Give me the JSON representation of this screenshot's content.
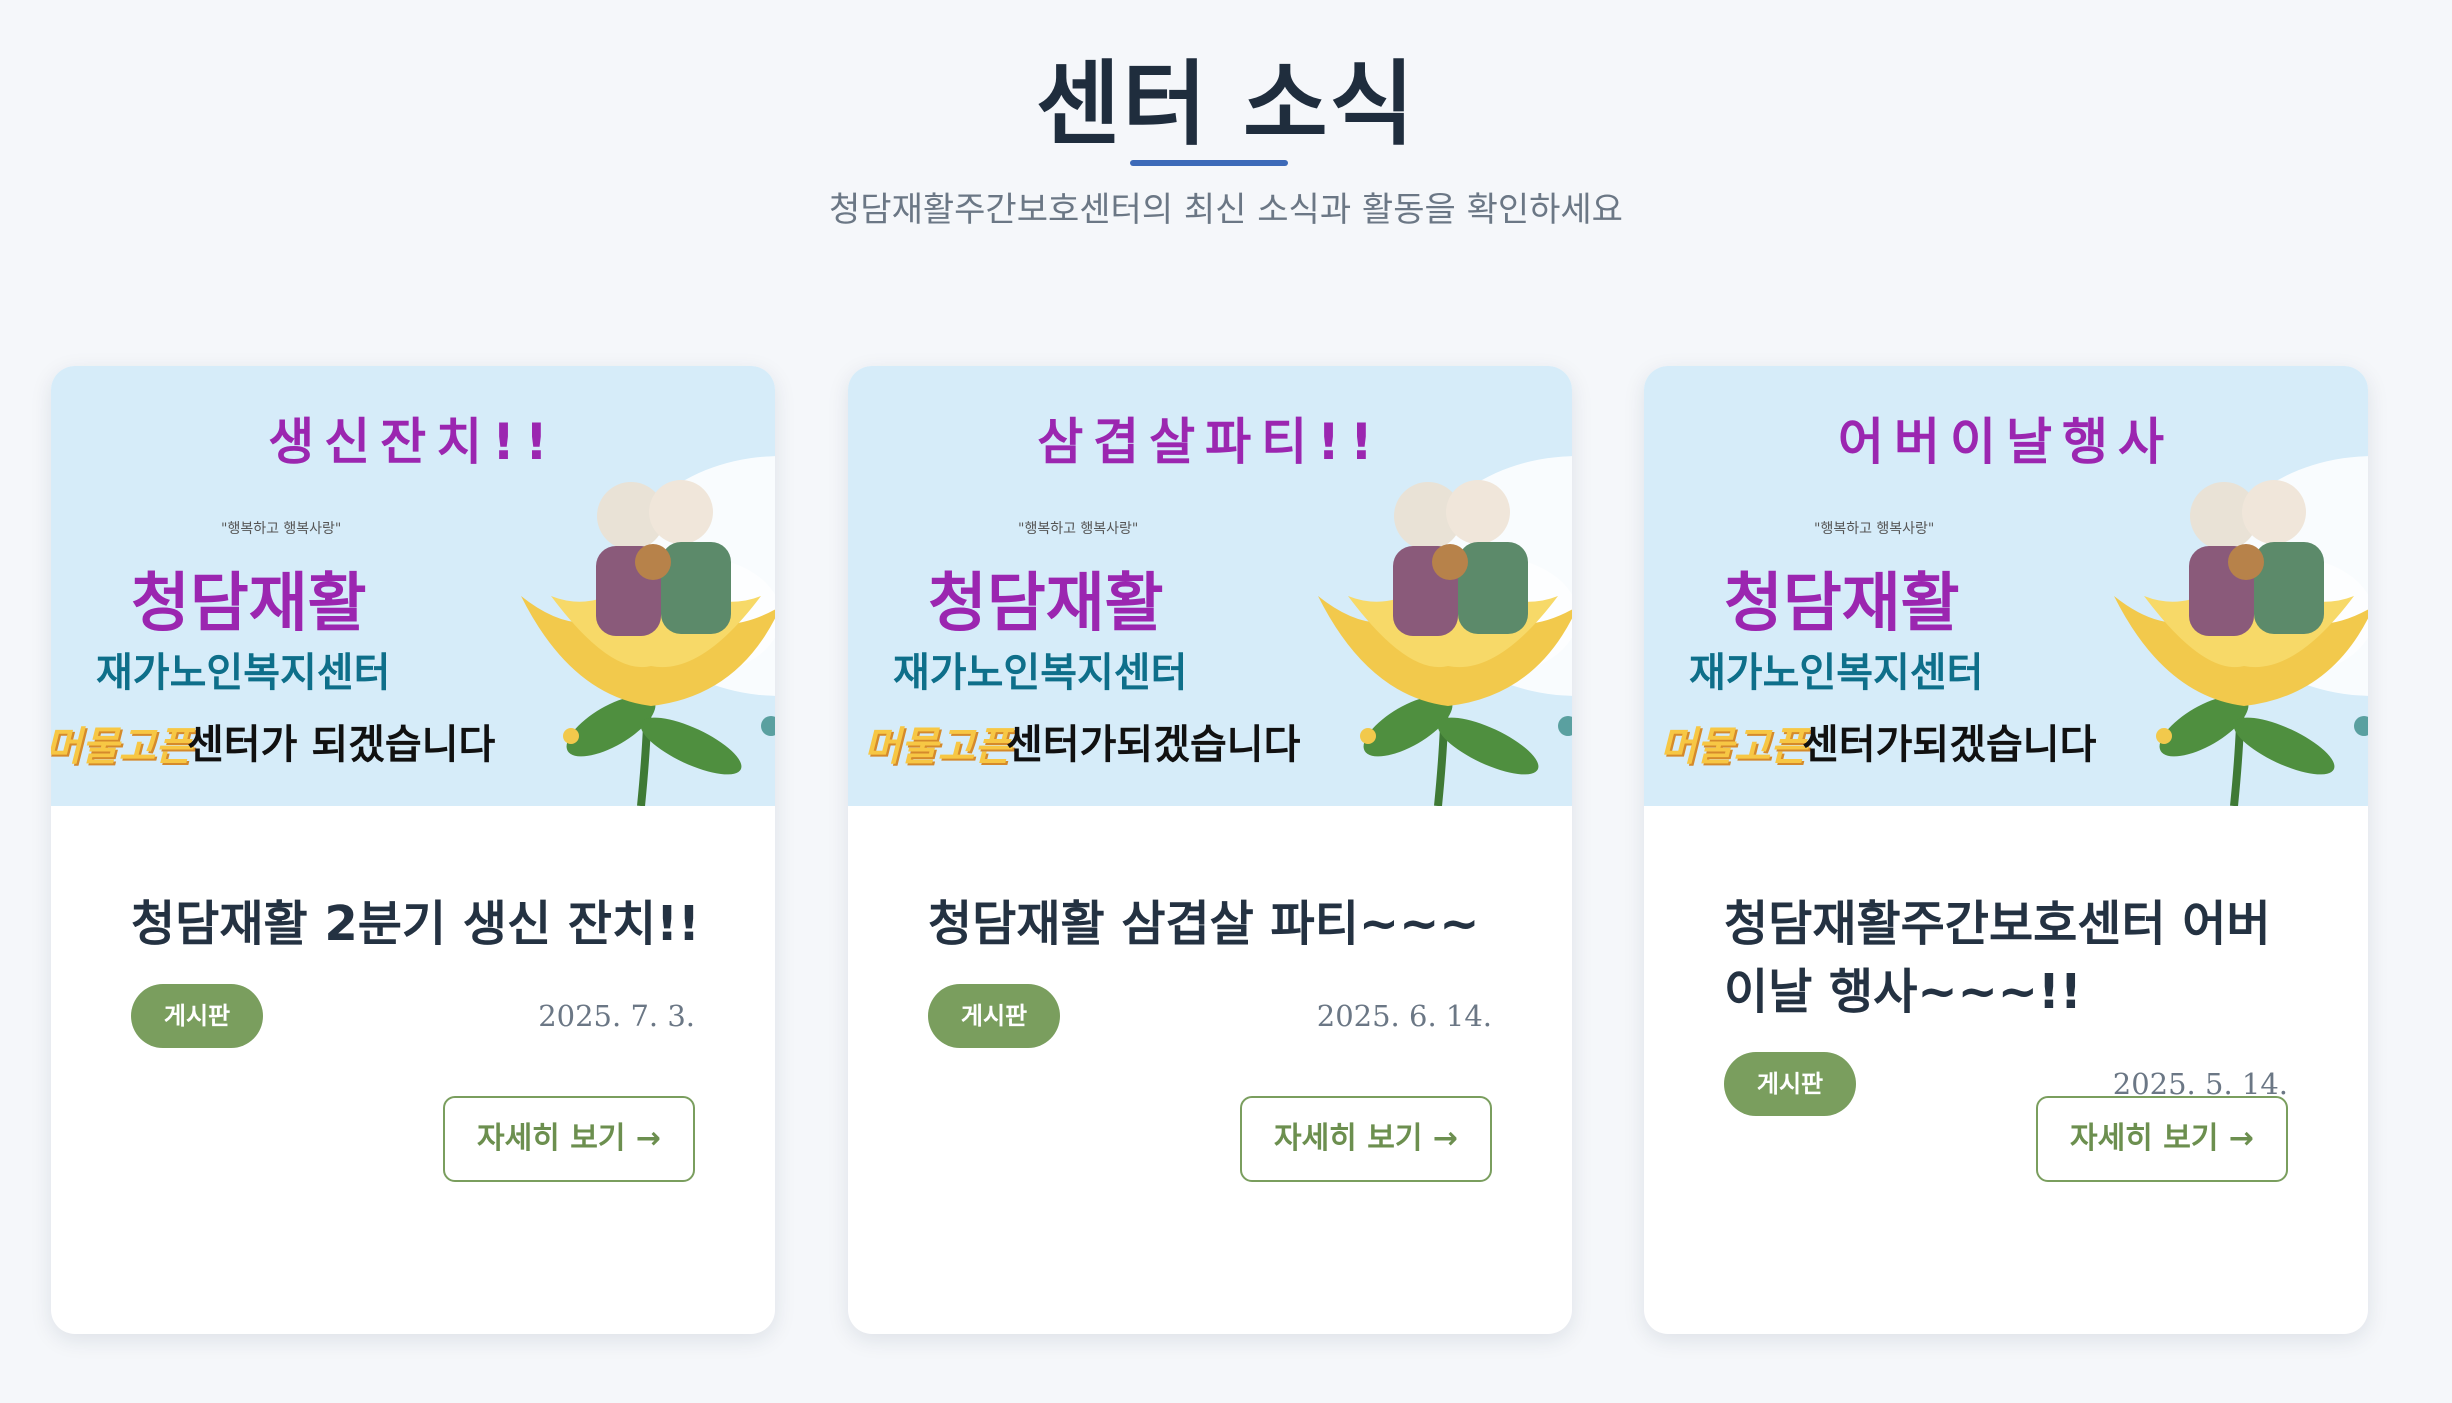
{
  "section": {
    "title": "센터 소식",
    "subtitle": "청담재활주간보호센터의 최신 소식과 활동을 확인하세요"
  },
  "colors": {
    "accent_blue": "#3d6ab8",
    "badge_green": "#7a9e5e",
    "thumb_bg": "#d6ecf9",
    "thumb_purple": "#9b26b0"
  },
  "cards": [
    {
      "thumbnail": {
        "headline": "생신잔치!!",
        "slogan_small": "\"행복하고 행복사랑\"",
        "brand": "청담재활",
        "org": "재가노인복지센터",
        "tag": "머물고픈",
        "tagline": "센터가 되겠습니다"
      },
      "title": "청담재활 2분기 생신 잔치!!",
      "badge": "게시판",
      "date": "2025. 7. 3.",
      "button": "자세히 보기 →"
    },
    {
      "thumbnail": {
        "headline": "삼겹살파티!!",
        "slogan_small": "\"행복하고 행복사랑\"",
        "brand": "청담재활",
        "org": "재가노인복지센터",
        "tag": "머물고픈",
        "tagline": "센터가되겠습니다"
      },
      "title": "청담재활 삼겹살 파티~~~",
      "badge": "게시판",
      "date": "2025. 6. 14.",
      "button": "자세히 보기 →"
    },
    {
      "thumbnail": {
        "headline": "어버이날행사",
        "slogan_small": "\"행복하고 행복사랑\"",
        "brand": "청담재활",
        "org": "재가노인복지센터",
        "tag": "머물고픈",
        "tagline": "센터가되겠습니다"
      },
      "title": "청담재활주간보호센터 어버이날 행사~~~!!",
      "badge": "게시판",
      "date": "2025. 5. 14.",
      "button": "자세히 보기 →"
    }
  ]
}
